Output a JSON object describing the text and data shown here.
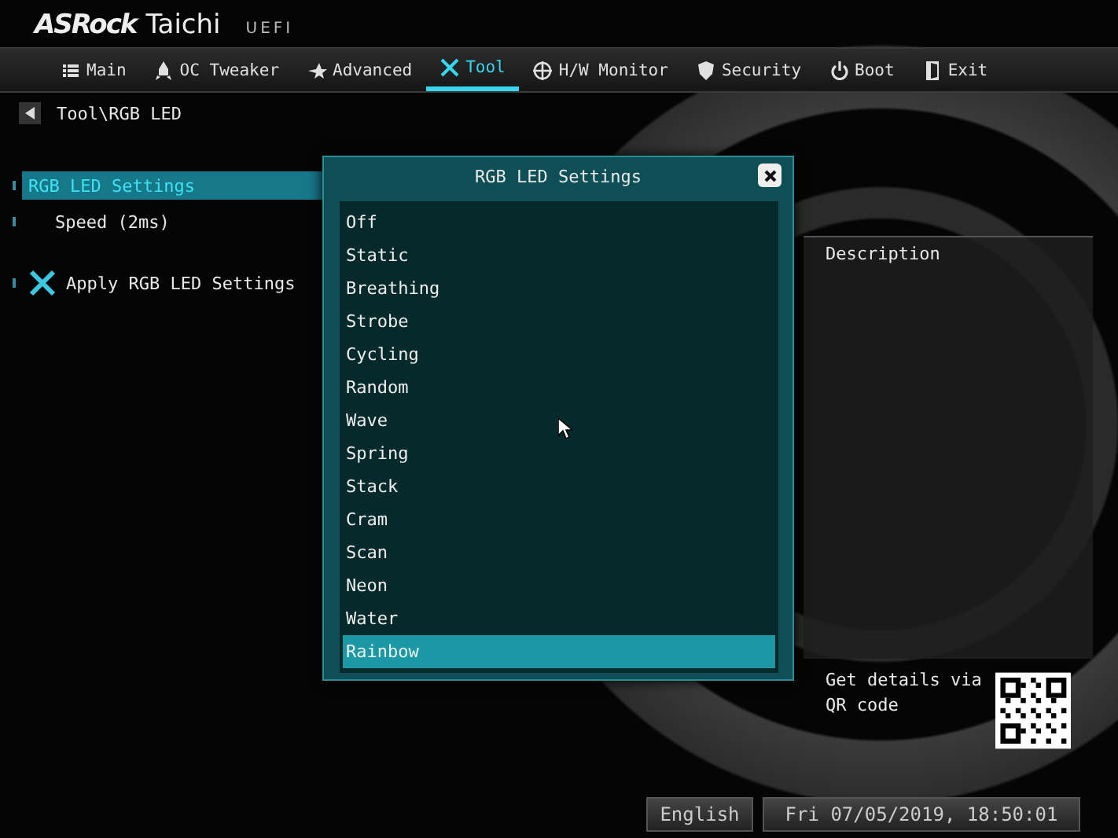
{
  "header": {
    "brand": "ASRock",
    "model": "Taichi",
    "firmware": "UEFI"
  },
  "tabs": [
    {
      "label": "Main",
      "kind": "list",
      "selected": false
    },
    {
      "label": "OC Tweaker",
      "kind": "rocket",
      "selected": false
    },
    {
      "label": "Advanced",
      "kind": "star",
      "selected": false
    },
    {
      "label": "Tool",
      "kind": "tools",
      "selected": true
    },
    {
      "label": "H/W Monitor",
      "kind": "target",
      "selected": false
    },
    {
      "label": "Security",
      "kind": "shield",
      "selected": false
    },
    {
      "label": "Boot",
      "kind": "power",
      "selected": false
    },
    {
      "label": "Exit",
      "kind": "door",
      "selected": false
    }
  ],
  "breadcrumb": "Tool\\RGB LED",
  "menu": [
    {
      "label": "RGB LED Settings",
      "kind": "setting",
      "selected": true
    },
    {
      "label": "Speed (2ms)",
      "kind": "sub",
      "selected": false
    },
    {
      "label": "Apply RGB LED Settings",
      "kind": "action",
      "selected": false
    }
  ],
  "description": {
    "title": "Description",
    "qr_text": "Get details via QR code"
  },
  "dialog": {
    "title": "RGB LED Settings",
    "options": [
      {
        "label": "Off",
        "selected": false
      },
      {
        "label": "Static",
        "selected": false
      },
      {
        "label": "Breathing",
        "selected": false
      },
      {
        "label": "Strobe",
        "selected": false
      },
      {
        "label": "Cycling",
        "selected": false
      },
      {
        "label": "Random",
        "selected": false
      },
      {
        "label": "Wave",
        "selected": false
      },
      {
        "label": "Spring",
        "selected": false
      },
      {
        "label": "Stack",
        "selected": false
      },
      {
        "label": "Cram",
        "selected": false
      },
      {
        "label": "Scan",
        "selected": false
      },
      {
        "label": "Neon",
        "selected": false
      },
      {
        "label": "Water",
        "selected": false
      },
      {
        "label": "Rainbow",
        "selected": true
      }
    ]
  },
  "footer": {
    "language": "English",
    "datetime": "Fri 07/05/2019, 18:50:01"
  }
}
